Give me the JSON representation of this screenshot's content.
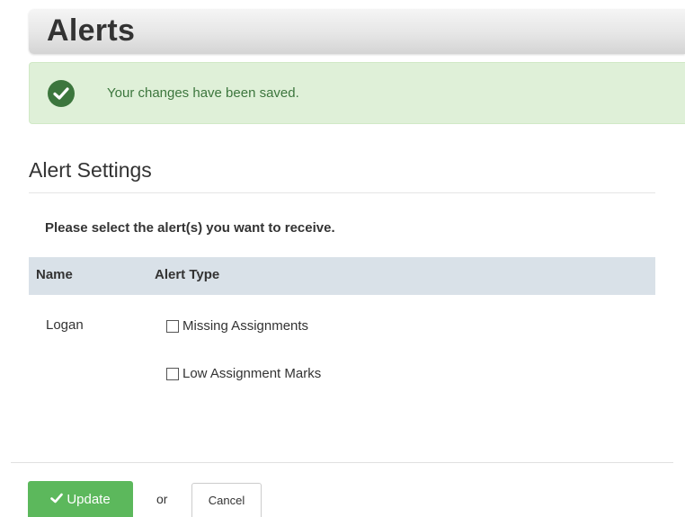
{
  "header": {
    "title": "Alerts"
  },
  "notification": {
    "message": "Your changes have been saved.",
    "icon": "check-circle-icon",
    "color": "#3c763d",
    "background": "#dff0d8"
  },
  "settings": {
    "title": "Alert Settings",
    "instructions": "Please select the alert(s) you want to receive.",
    "columns": [
      "Name",
      "Alert Type"
    ],
    "rows": [
      {
        "name": "Logan",
        "alerts": [
          {
            "label": "Missing Assignments",
            "checked": false
          },
          {
            "label": "Low Assignment Marks",
            "checked": false
          }
        ]
      }
    ]
  },
  "footer": {
    "update_label": "Update",
    "or_label": "or",
    "cancel_label": "Cancel",
    "update_color": "#5cb85c"
  }
}
